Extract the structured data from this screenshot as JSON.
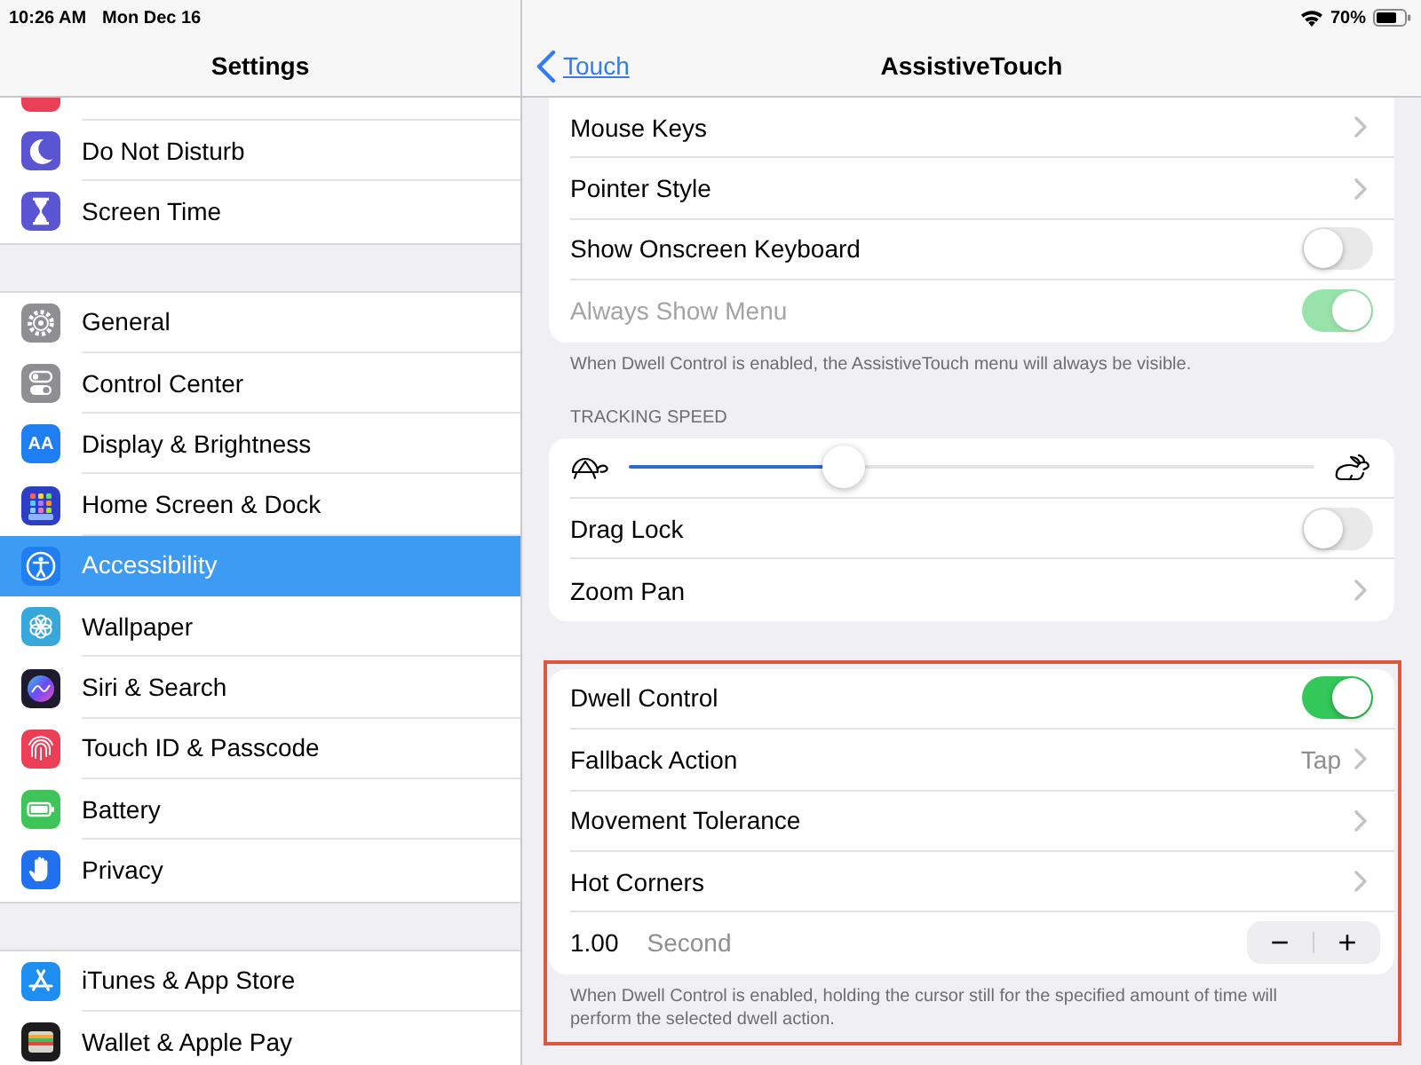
{
  "status_bar": {
    "time": "10:26 AM",
    "date": "Mon Dec 16",
    "battery": "70%"
  },
  "sidebar": {
    "title": "Settings",
    "groups": [
      {
        "items": [
          {
            "kind": "partial",
            "color": "#ea3f57",
            "selected": false
          },
          {
            "kind": "row",
            "label": "Do Not Disturb",
            "color": "#5a55d3",
            "selected": false
          },
          {
            "kind": "row",
            "label": "Screen Time",
            "color": "#5a55d3",
            "selected": false
          }
        ]
      },
      {
        "items": [
          {
            "kind": "row",
            "label": "General",
            "color": "#8e8e93",
            "selected": false
          },
          {
            "kind": "row",
            "label": "Control Center",
            "color": "#8e8e93",
            "selected": false
          },
          {
            "kind": "row",
            "label": "Display & Brightness",
            "color": "#1f7ff0",
            "glyph": "AA",
            "selected": false
          },
          {
            "kind": "row",
            "label": "Home Screen & Dock",
            "color": "#2b3ec4",
            "selected": false
          },
          {
            "kind": "row",
            "label": "Accessibility",
            "color": "#1f7ff0",
            "selected": true
          },
          {
            "kind": "row",
            "label": "Wallpaper",
            "color": "#37a8d9",
            "selected": false
          },
          {
            "kind": "row",
            "label": "Siri & Search",
            "color": "#1e1b2e",
            "selected": false
          },
          {
            "kind": "row",
            "label": "Touch ID & Passcode",
            "color": "#ea3f57",
            "selected": false
          },
          {
            "kind": "row",
            "label": "Battery",
            "color": "#3ec459",
            "selected": false
          },
          {
            "kind": "row",
            "label": "Privacy",
            "color": "#2170ee",
            "selected": false
          }
        ]
      },
      {
        "items": [
          {
            "kind": "row",
            "label": "iTunes & App Store",
            "color": "#1f8ef1",
            "selected": false
          },
          {
            "kind": "row",
            "label": "Wallet & Apple Pay",
            "color": "#1c1c1e",
            "selected": false
          }
        ]
      }
    ]
  },
  "detail": {
    "back": "Touch",
    "title": "AssistiveTouch",
    "sections": [
      {
        "rows": [
          {
            "kind": "link",
            "label": "Mouse Keys"
          },
          {
            "kind": "link",
            "label": "Pointer Style"
          },
          {
            "kind": "toggle",
            "label": "Show Onscreen Keyboard",
            "on": false,
            "disabled": false
          },
          {
            "kind": "toggle",
            "label": "Always Show Menu",
            "on": true,
            "disabled": true
          }
        ],
        "footer": "When Dwell Control is enabled, the AssistiveTouch menu will always be visible."
      },
      {
        "header": "TRACKING SPEED",
        "rows": [
          {
            "kind": "slider",
            "level": 0.3
          },
          {
            "kind": "toggle",
            "label": "Drag Lock",
            "on": false,
            "disabled": false
          },
          {
            "kind": "link",
            "label": "Zoom Pan"
          }
        ]
      },
      {
        "highlighted": true,
        "rows": [
          {
            "kind": "toggle",
            "label": "Dwell Control",
            "on": true,
            "disabled": false
          },
          {
            "kind": "link",
            "label": "Fallback Action",
            "value": "Tap"
          },
          {
            "kind": "link",
            "label": "Movement Tolerance"
          },
          {
            "kind": "link",
            "label": "Hot Corners"
          },
          {
            "kind": "stepper",
            "value": "1.00",
            "unit": "Second",
            "decrement": "−",
            "increment": "+"
          }
        ],
        "footer": "When Dwell Control is enabled, holding the cursor still for the specified amount of time will perform the selected dwell action."
      }
    ]
  }
}
